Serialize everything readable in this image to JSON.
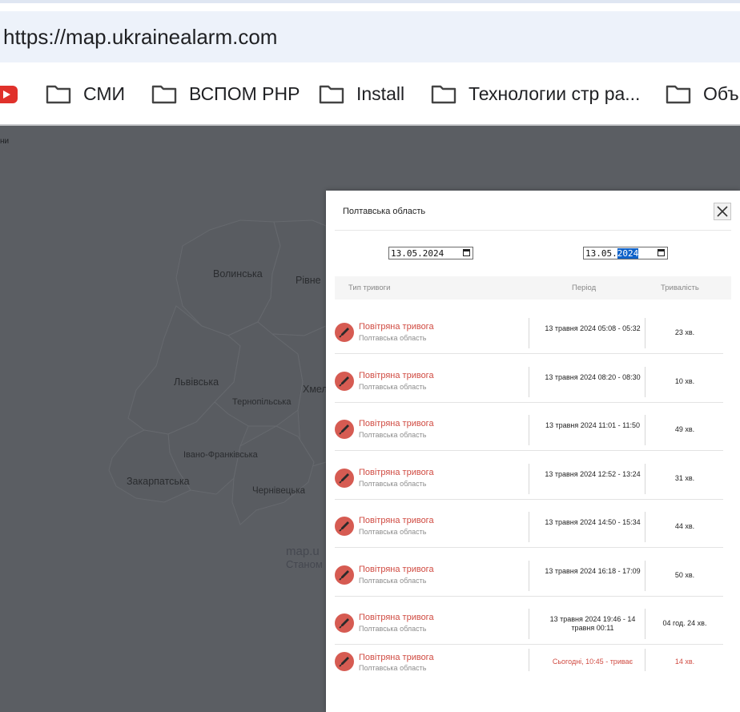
{
  "browser": {
    "url": "https://map.ukrainealarm.com",
    "bookmarks": [
      {
        "label": "СМИ"
      },
      {
        "label": "ВСПОМ PHP"
      },
      {
        "label": "Install"
      },
      {
        "label": "Технологии стр ра..."
      },
      {
        "label": "Объ"
      }
    ]
  },
  "map": {
    "corner_label": "ни",
    "regions": [
      "Волинська",
      "Рівне",
      "Львівська",
      "Хмел",
      "Тернопільська",
      "Івано-Франківська",
      "Закарпатська",
      "Чернівецька"
    ],
    "watermark_line1": "map.u",
    "watermark_line2": "Станом"
  },
  "modal": {
    "title": "Полтавська область",
    "date_from": {
      "day": "13",
      "month": "05",
      "year": "2024"
    },
    "date_to": {
      "day": "13",
      "month": "05",
      "year": "2024"
    },
    "columns": {
      "type": "Тип тривоги",
      "period": "Період",
      "duration": "Тривалість"
    },
    "rows": [
      {
        "title": "Повітряна тривога",
        "region": "Полтавська область",
        "period": "13 травня 2024 05:08 - 05:32",
        "duration": "23 хв."
      },
      {
        "title": "Повітряна тривога",
        "region": "Полтавська область",
        "period": "13 травня 2024 08:20 - 08:30",
        "duration": "10 хв."
      },
      {
        "title": "Повітряна тривога",
        "region": "Полтавська область",
        "period": "13 травня 2024 11:01 - 11:50",
        "duration": "49 хв."
      },
      {
        "title": "Повітряна тривога",
        "region": "Полтавська область",
        "period": "13 травня 2024 12:52 - 13:24",
        "duration": "31 хв."
      },
      {
        "title": "Повітряна тривога",
        "region": "Полтавська область",
        "period": "13 травня 2024 14:50 - 15:34",
        "duration": "44 хв."
      },
      {
        "title": "Повітряна тривога",
        "region": "Полтавська область",
        "period": "13 травня 2024 16:18 - 17:09",
        "duration": "50 хв."
      },
      {
        "title": "Повітряна тривога",
        "region": "Полтавська область",
        "period": "13 травня 2024 19:46 - 14 травня 00:11",
        "duration": "04 год. 24 хв."
      },
      {
        "title": "Повітряна тривога",
        "region": "Полтавська область",
        "period": "Сьогодні, 10:45 - триває",
        "duration": "14 хв."
      }
    ]
  },
  "colors": {
    "alert": "#d04b42",
    "map_bg": "#5b5e63",
    "selection": "#0f62c9"
  },
  "icons": {
    "close": "close-icon",
    "alert": "rocket-icon",
    "folder": "folder-icon",
    "calendar": "calendar-icon"
  }
}
